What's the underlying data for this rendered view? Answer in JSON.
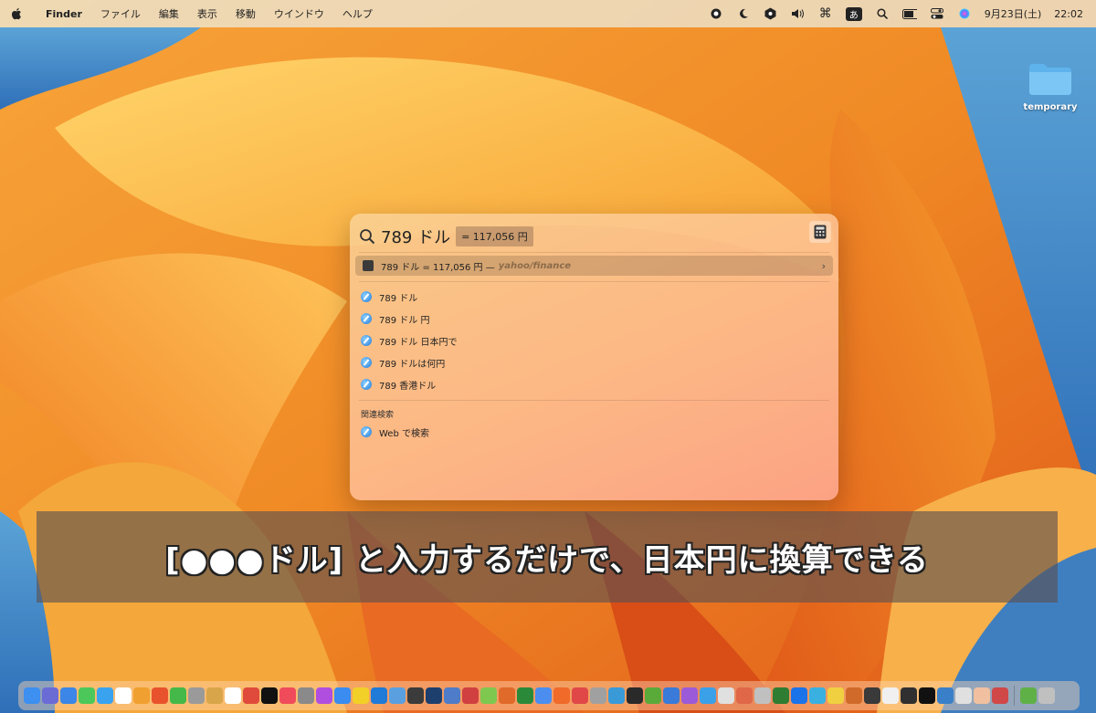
{
  "menubar": {
    "apple_icon": "apple-icon",
    "app_name": "Finder",
    "menus": [
      "ファイル",
      "編集",
      "表示",
      "移動",
      "ウインドウ",
      "ヘルプ"
    ],
    "status_icons": [
      "record-icon",
      "moon-icon",
      "hex-icon",
      "volume-icon",
      "command-icon"
    ],
    "ime_label": "あ",
    "status_icons_2": [
      "search-icon",
      "battery-icon",
      "control-center-icon",
      "siri-icon"
    ],
    "date": "9月23日(土)",
    "time": "22:02"
  },
  "desktop": {
    "folder_label": "temporary"
  },
  "spotlight": {
    "query": "789 ドル",
    "inline_result": "= 117,056 円",
    "top_hit": {
      "text": "789 ドル = 117,056 円 —",
      "source": "yahoo/finance"
    },
    "suggestions": [
      "789 ドル",
      "789 ドル 円",
      "789 ドル 日本円で",
      "789 ドルは何円",
      "789 香港ドル"
    ],
    "related_section": "関連検索",
    "related_item": "Web で検索"
  },
  "subtitle": "[●●●ドル] と入力するだけで、日本円に換算できる",
  "dock": {
    "colors": [
      "#3d8ff0",
      "#6b6bd6",
      "#3b86e6",
      "#4cc85a",
      "#39a3f0",
      "#ffffff",
      "#f0a030",
      "#e8532d",
      "#44b848",
      "#9a9a9a",
      "#d9a54a",
      "#ffffff",
      "#e04a3a",
      "#111111",
      "#f04b5b",
      "#8a8a8a",
      "#b04ee0",
      "#3a8cf0",
      "#f2d027",
      "#1f7ad8",
      "#5aa0e0",
      "#3b3b3b",
      "#1c3f6e",
      "#4e7cc8",
      "#d04040",
      "#7ec850",
      "#e06a2a",
      "#2a8a3a",
      "#4c8ef0",
      "#f06a2a",
      "#e04848",
      "#a0a0a0",
      "#3a9ad8",
      "#2a2a2a",
      "#5aaa3a",
      "#3a7ad8",
      "#9b5bd8",
      "#3aa0e8",
      "#e0e0e0",
      "#e06848",
      "#c0c0c0",
      "#2e7d32",
      "#1a73e8",
      "#3ab0e0",
      "#f0d040",
      "#d06a2a",
      "#3a3a3a",
      "#f0f0f0",
      "#303030",
      "#111111",
      "#3a80c8",
      "#e0e0e0",
      "#f0c0a0",
      "#d04848",
      "#60b048",
      "#c0c0c0"
    ]
  }
}
